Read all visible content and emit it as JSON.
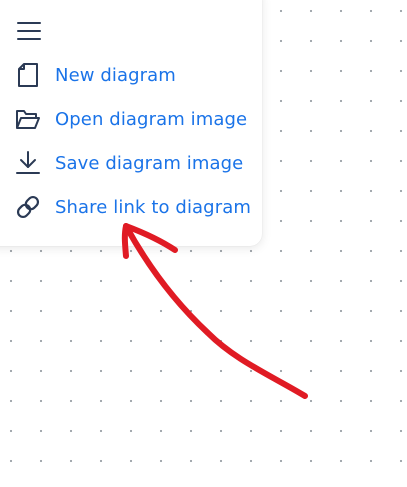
{
  "menu": {
    "toggle_icon": "hamburger-menu-icon",
    "items": [
      {
        "icon": "file-icon",
        "label": "New diagram"
      },
      {
        "icon": "folder-open-icon",
        "label": "Open diagram image"
      },
      {
        "icon": "download-icon",
        "label": "Save diagram image"
      },
      {
        "icon": "link-icon",
        "label": "Share link to diagram"
      }
    ]
  },
  "annotation": {
    "icon": "arrow-annotation-icon",
    "color": "#e01b24"
  },
  "colors": {
    "link": "#1a73e8",
    "icon": "#2b3a55",
    "canvas_dot": "#9aa0a6"
  }
}
